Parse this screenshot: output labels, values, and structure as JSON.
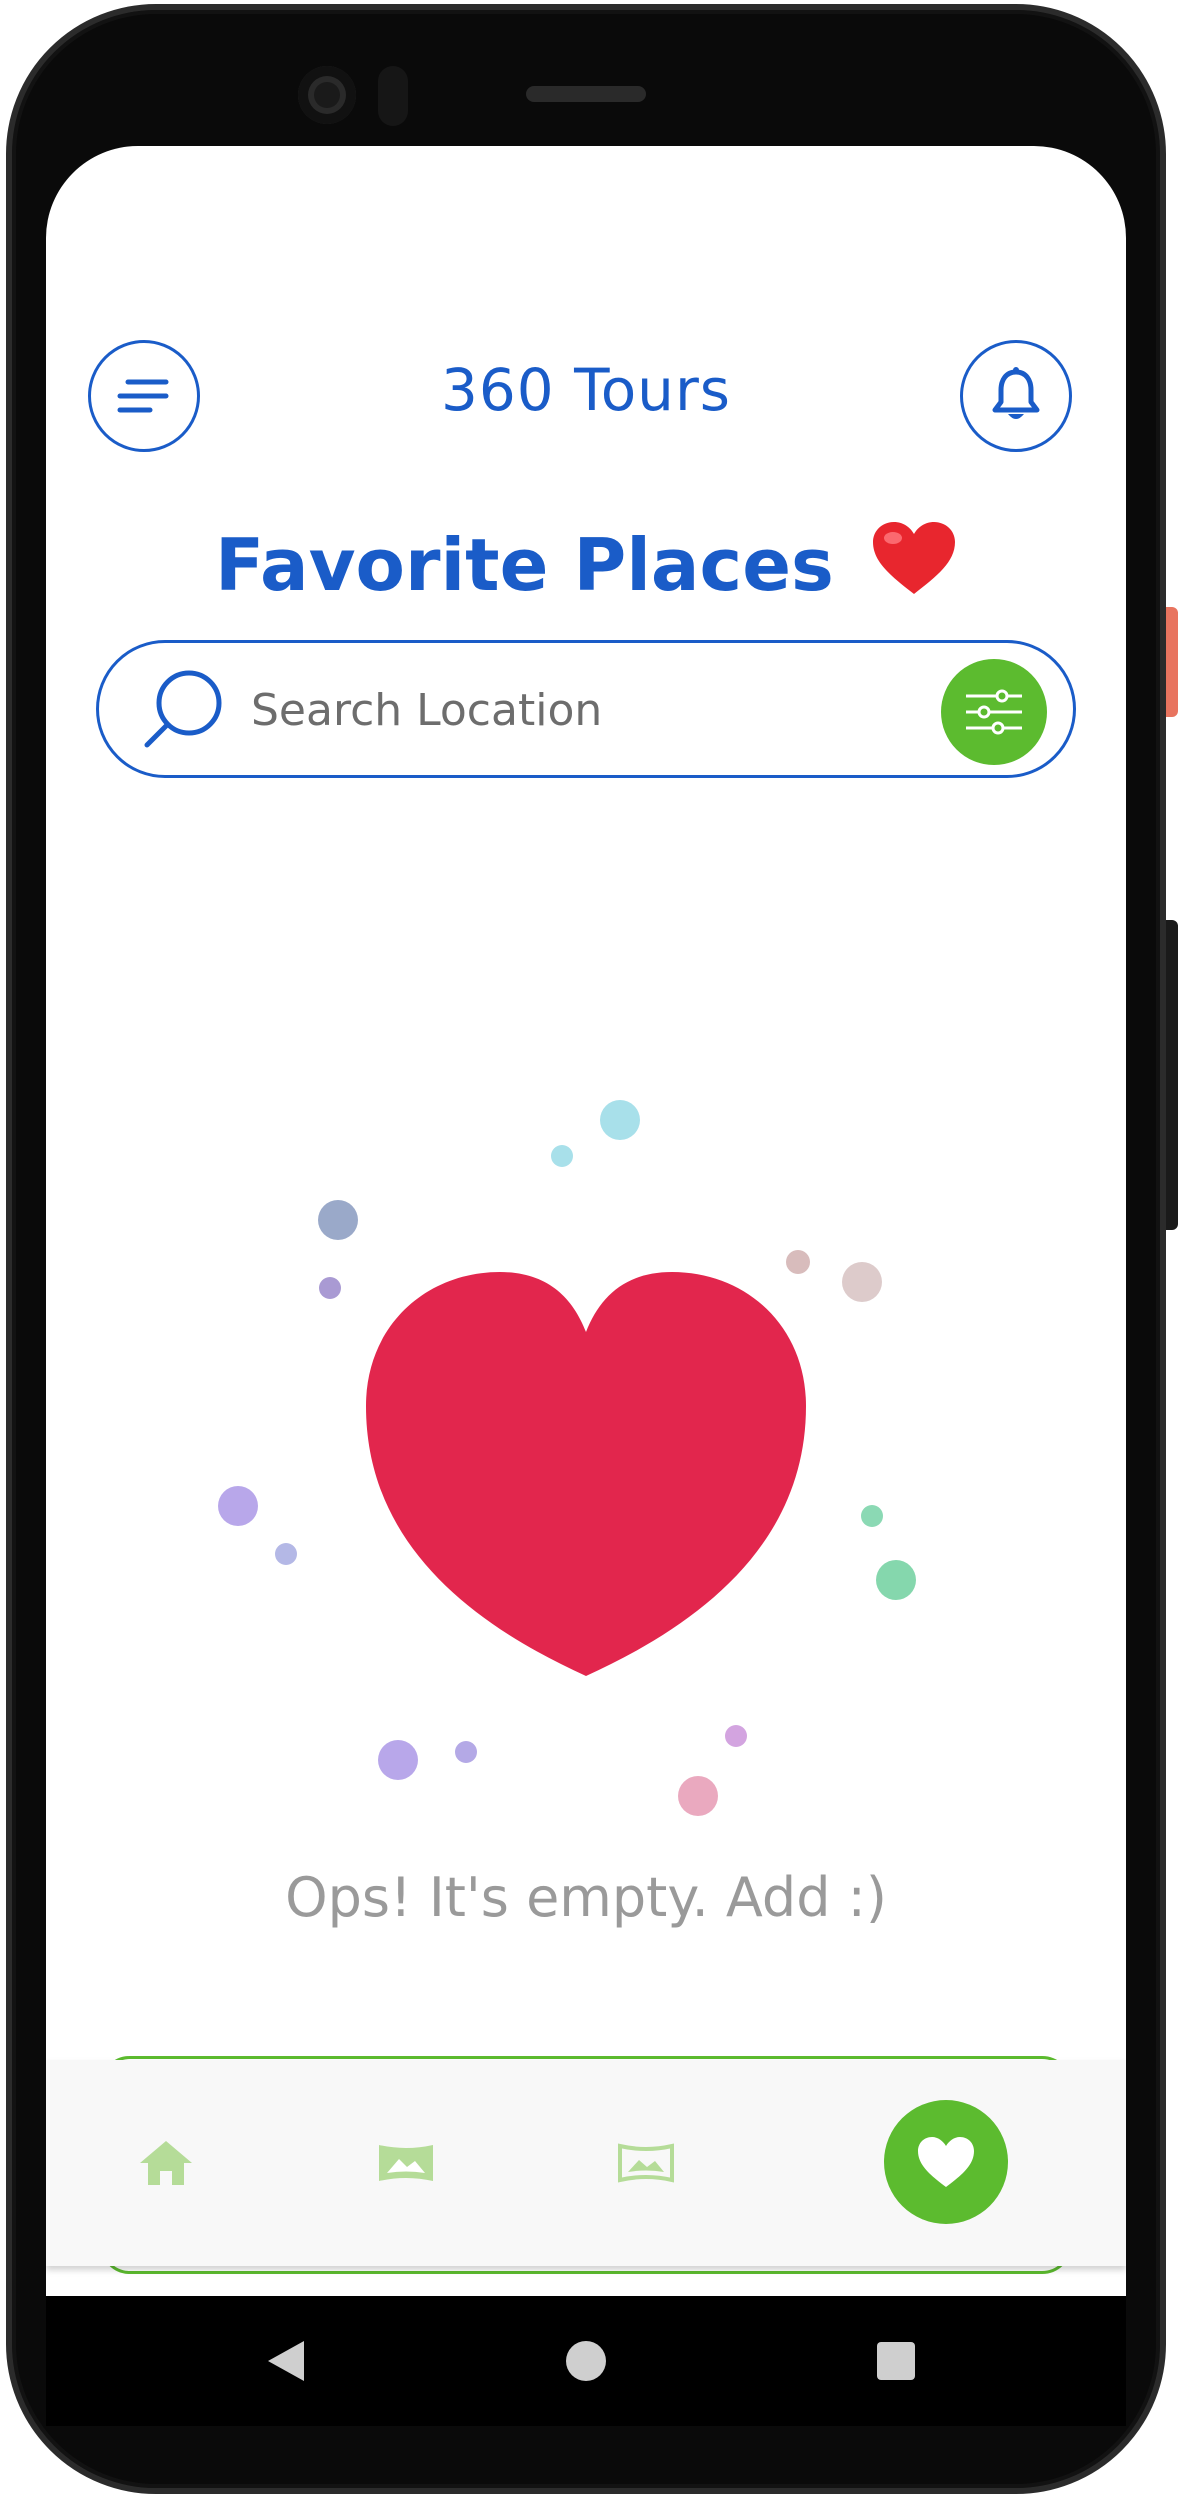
{
  "header": {
    "app_title": "360 Tours",
    "page_title": "Favorite Places",
    "page_title_emoji": "❤️"
  },
  "search": {
    "placeholder": "Search Location",
    "value": ""
  },
  "empty_state": {
    "message": "Ops! It's empty. Add :)"
  },
  "bottom_nav": {
    "items": [
      {
        "name": "home",
        "icon": "home-icon",
        "active": false
      },
      {
        "name": "gallery",
        "icon": "panorama-icon",
        "active": false
      },
      {
        "name": "tours",
        "icon": "panorama-outline-icon",
        "active": false
      },
      {
        "name": "favorites",
        "icon": "heart-icon",
        "active": true
      }
    ]
  },
  "colors": {
    "primary_blue": "#1a5cc8",
    "accent_green": "#5cbb2f",
    "heart_red": "#e2264d",
    "muted_text": "#9a9a9a"
  }
}
